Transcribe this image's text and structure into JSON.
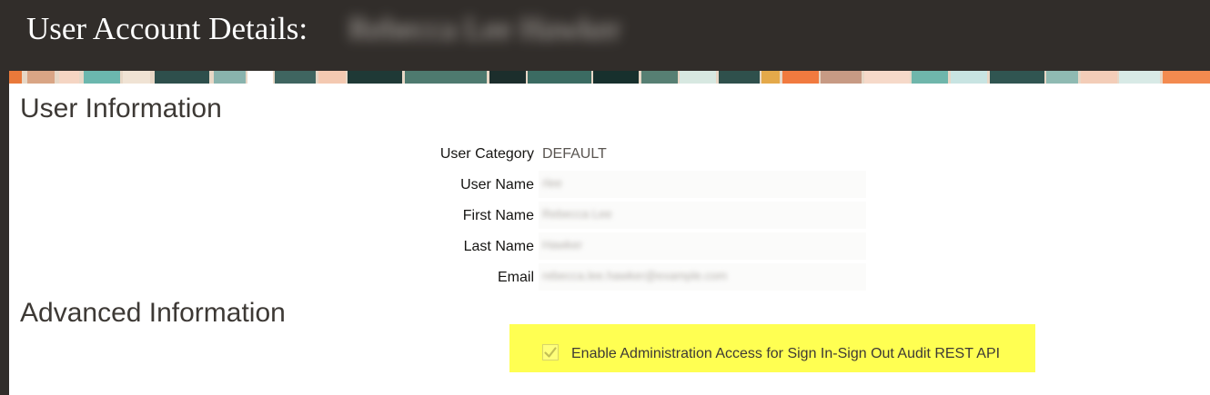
{
  "header": {
    "title": "User Account Details:",
    "user_full_name": "Rebecca Lee Hawker"
  },
  "sections": {
    "user_information": "User Information",
    "advanced_information": "Advanced Information"
  },
  "fields": {
    "user_category": {
      "label": "User Category",
      "value": "DEFAULT"
    },
    "user_name": {
      "label": "User Name",
      "value": "rlee"
    },
    "first_name": {
      "label": "First Name",
      "value": "Rebecca Lee"
    },
    "last_name": {
      "label": "Last Name",
      "value": "Hawker"
    },
    "email": {
      "label": "Email",
      "value": "rebecca.lee.hawker@example.com"
    }
  },
  "advanced": {
    "checkbox_label": "Enable Administration Access for Sign In-Sign Out Audit REST API",
    "checked": true,
    "disabled": true,
    "highlight_color": "#ffff52"
  },
  "colors": {
    "title_bar": "#312d2a",
    "heading_text": "#3d3935"
  }
}
